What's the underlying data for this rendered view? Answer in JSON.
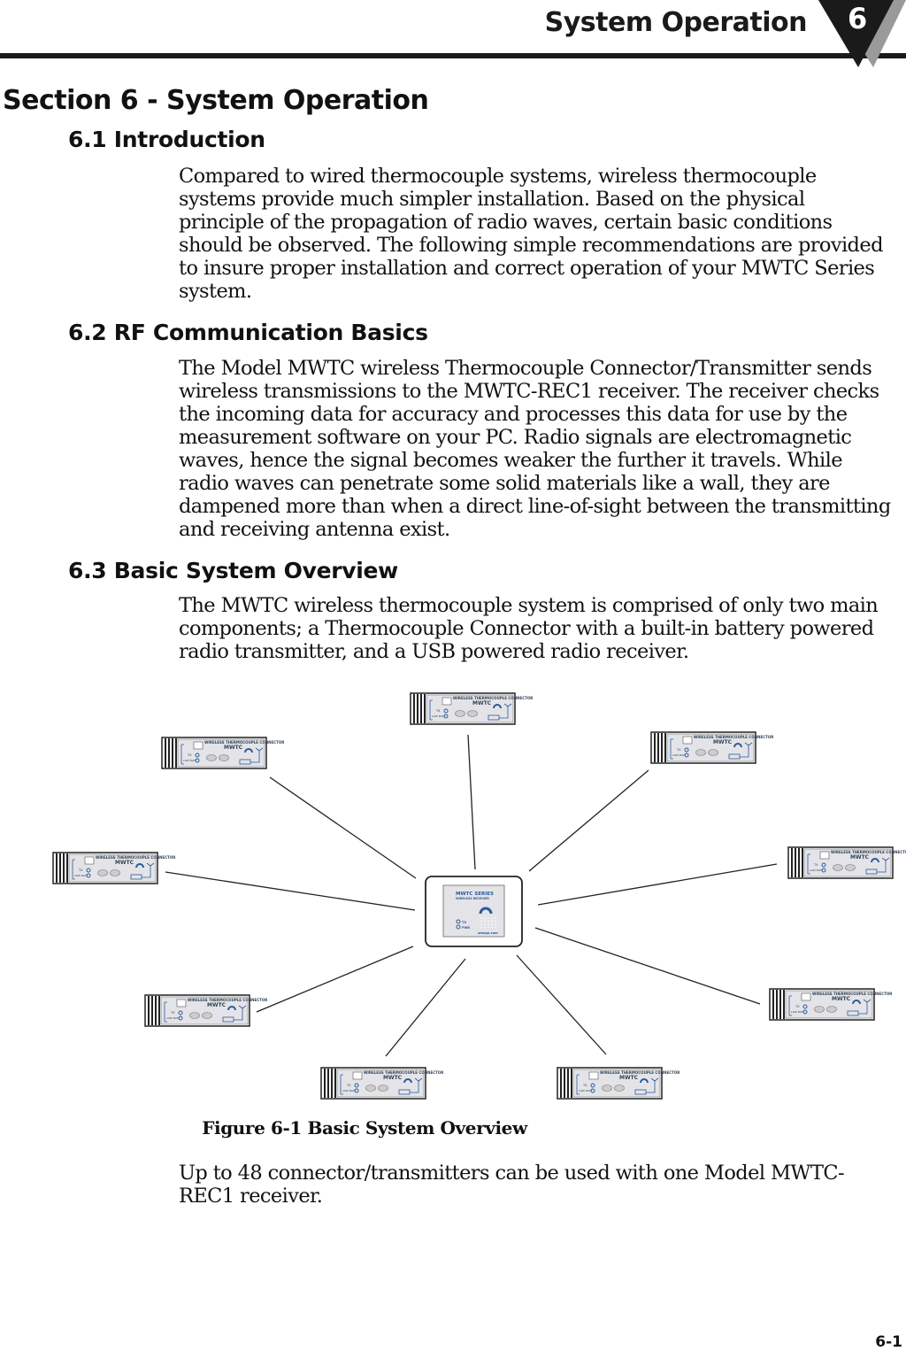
{
  "header": {
    "title": "System Operation",
    "chapter_number": "6"
  },
  "section_title": "Section 6 - System Operation",
  "sections": [
    {
      "heading": "6.1 Introduction",
      "body": "Compared to wired thermocouple systems, wireless thermocouple systems provide much simpler installation. Based on the physical principle of the propagation of radio waves, certain basic conditions should be observed. The following simple recommendations are provided to insure proper installation and correct operation of your MWTC Series system."
    },
    {
      "heading": "6.2 RF Communication Basics",
      "body": "The Model MWTC wireless Thermocouple Connector/Transmitter sends wireless transmissions to the MWTC-REC1 receiver. The receiver checks the incoming data for accuracy and processes this data for use by the measurement software on your PC. Radio signals are electromagnetic waves, hence the signal becomes weaker the further it travels. While radio waves can penetrate some solid materials like a wall, they are dampened more than when a direct line-of-sight between the transmitting and receiving antenna exist."
    },
    {
      "heading": "6.3 Basic System Overview",
      "body": "The MWTC wireless thermocouple system is comprised of only two main components; a Thermocouple Connector with a built-in battery powered radio transmitter, and a USB powered radio receiver."
    }
  ],
  "figure": {
    "caption": "Figure 6-1  Basic System Overview",
    "transmitter": {
      "label": "WIRELESS THERMOCOUPLE CONNECTOR",
      "model": "MWTC",
      "led_tx": "TX",
      "led_batt": "LOW BATT"
    },
    "receiver": {
      "title": "MWTC SERIES",
      "subtitle": "WIRELESS RECEIVER",
      "led_tx": "TX",
      "led_pwr": "PWR",
      "brand": "omega.com"
    },
    "transmitter_count_shown": 9
  },
  "footer_text": "Up to 48 connector/transmitters can be used with one Model MWTC-REC1 receiver.",
  "page_number": "6-1"
}
